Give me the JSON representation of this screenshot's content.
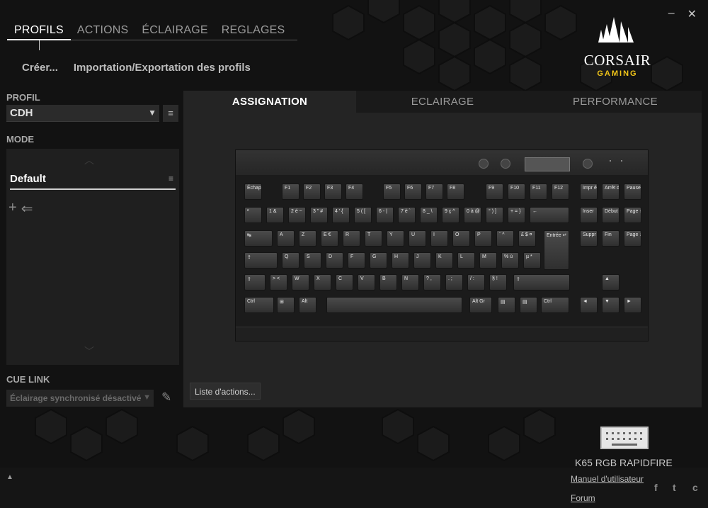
{
  "window": {
    "minimize_glyph": "–",
    "close_glyph": "✕"
  },
  "nav": {
    "tabs": [
      {
        "label": "PROFILS",
        "active": true
      },
      {
        "label": "ACTIONS",
        "active": false
      },
      {
        "label": "ÉCLAIRAGE",
        "active": false
      },
      {
        "label": "REGLAGES",
        "active": false
      }
    ],
    "sub": {
      "create": "Créer...",
      "import_export": "Importation/Exportation des profils"
    }
  },
  "logo": {
    "brand": "CORSAIR",
    "sub": "GAMING",
    "accent": "#f0c419"
  },
  "profile": {
    "label": "PROFIL",
    "value": "CDH",
    "menu_icon": "≡"
  },
  "mode": {
    "label": "MODE",
    "item": "Default",
    "item_menu_icon": "≡",
    "add_icon": "+",
    "import_icon": "⇐"
  },
  "cue_link": {
    "label": "CUE LINK",
    "value": "Éclairage synchronisé désactivé"
  },
  "main": {
    "tabs": [
      {
        "label": "ASSIGNATION",
        "active": true
      },
      {
        "label": "ECLAIRAGE",
        "active": false
      },
      {
        "label": "PERFORMANCE",
        "active": false
      }
    ],
    "action_list_button": "Liste d'actions..."
  },
  "keyboard": {
    "rows": [
      [
        "Échap",
        "F1",
        "F2",
        "F3",
        "F4",
        "F5",
        "F6",
        "F7",
        "F8",
        "F9",
        "F10",
        "F11",
        "F12",
        "Impr écran",
        "Arrêt défil",
        "Pause Attn"
      ],
      [
        "²",
        "1 &",
        "2 é ~",
        "3 \" #",
        "4 ' {",
        "5 ( [",
        "6 - |",
        "7 è `",
        "8 _ \\",
        "9 ç ^",
        "0 à @",
        "° ) ]",
        "+ = }",
        "←",
        "Inser",
        "Début",
        "Page ↑"
      ],
      [
        "↹",
        "A",
        "Z",
        "E €",
        "R",
        "T",
        "Y",
        "U",
        "I",
        "O",
        "P",
        "¨ ^",
        "£ $ ¤",
        "Entrée ↵",
        "Suppr",
        "Fin",
        "Page ↓"
      ],
      [
        "⇪",
        "Q",
        "S",
        "D",
        "F",
        "G",
        "H",
        "J",
        "K",
        "L",
        "M",
        "% ù",
        "µ *"
      ],
      [
        "⇧",
        "> <",
        "W",
        "X",
        "C",
        "V",
        "B",
        "N",
        "? ,",
        ". ;",
        "/ :",
        "§ !",
        "⇧",
        "▲"
      ],
      [
        "Ctrl",
        "⊞",
        "Alt",
        "",
        "Alt Gr",
        "▤",
        "▤",
        "Ctrl",
        "◄",
        "▼",
        "►"
      ]
    ]
  },
  "footer": {
    "up_glyph": "▲",
    "device_name": "K65 RGB RAPIDFIRE",
    "manual_link": "Manuel d'utilisateur",
    "forum_link": "Forum",
    "social": [
      "f",
      "t",
      "c"
    ]
  }
}
